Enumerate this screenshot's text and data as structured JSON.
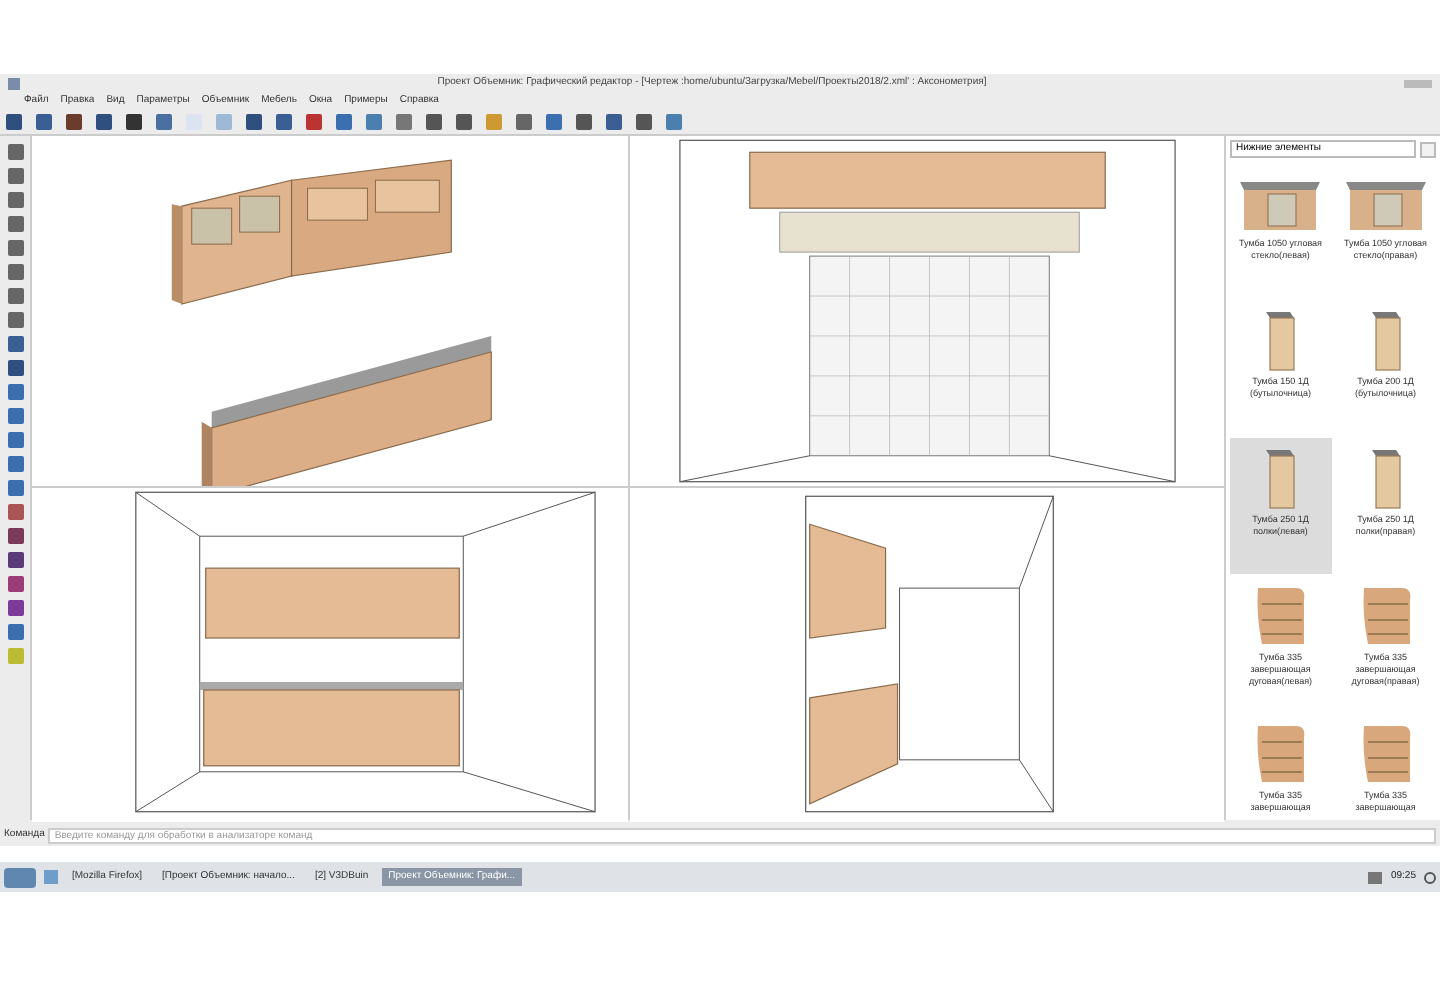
{
  "window": {
    "title": "Проект Объемник: Графический редактор - [Чертеж :home/ubuntu/Загрузка/Mebel/Проекты2018/2.xml' : Аксонометрия]"
  },
  "menu": [
    "Файл",
    "Правка",
    "Вид",
    "Параметры",
    "Объемник",
    "Мебель",
    "Окна",
    "Примеры",
    "Справка"
  ],
  "library": {
    "category": "Нижние элементы",
    "items": [
      {
        "label": "Тумба 1050 угловая стекло(левая)",
        "kind": "corner",
        "selected": false
      },
      {
        "label": "Тумба 1050 угловая стекло(правая)",
        "kind": "corner",
        "selected": false
      },
      {
        "label": "Тумба 150 1Д (бутылочница)",
        "kind": "narrow",
        "selected": false
      },
      {
        "label": "Тумба 200 1Д (бутылочница)",
        "kind": "narrow",
        "selected": false
      },
      {
        "label": "Тумба 250 1Д полки(левая)",
        "kind": "narrow",
        "selected": true
      },
      {
        "label": "Тумба 250 1Д полки(правая)",
        "kind": "narrow",
        "selected": false
      },
      {
        "label": "Тумба 335 завершающая дуговая(левая)",
        "kind": "arc",
        "selected": false
      },
      {
        "label": "Тумба 335 завершающая дуговая(правая)",
        "kind": "arc",
        "selected": false
      },
      {
        "label": "Тумба 335 завершающая",
        "kind": "arc",
        "selected": false
      },
      {
        "label": "Тумба 335 завершающая",
        "kind": "arc",
        "selected": false
      }
    ]
  },
  "command": {
    "label": "Команда",
    "placeholder": "Введите команду для обработки в анализаторе команд"
  },
  "taskbar": {
    "tasks": [
      {
        "label": "[Mozilla Firefox]",
        "selected": false
      },
      {
        "label": "[Проект Объемник: начало...",
        "selected": false
      },
      {
        "label": "[2] V3DBuin",
        "selected": false
      },
      {
        "label": "Проект Объемник: Графи...",
        "selected": true
      }
    ],
    "clock": "09:25"
  }
}
